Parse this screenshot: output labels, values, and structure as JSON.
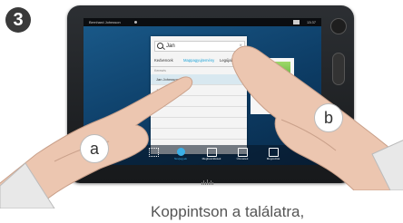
{
  "step_number": "3",
  "screen": {
    "status_bar": {
      "user": "Bernhard Johnsson",
      "time": "13:37"
    },
    "search": {
      "query": "Jan"
    },
    "tabs": [
      "Kedvencek",
      "Mappagyujtemény",
      "Legújabbak"
    ],
    "section_label": "Keresés",
    "results": [
      {
        "name": "Jan Johnsson",
        "selected": true
      },
      {
        "name": "Jan Nielsen",
        "selected": false
      },
      {
        "name": "",
        "selected": false
      },
      {
        "name": "",
        "selected": false
      },
      {
        "name": "",
        "selected": false
      },
      {
        "name": "",
        "selected": false
      }
    ],
    "bottom_bar": [
      {
        "label": "",
        "icon": "keypad-icon"
      },
      {
        "label": "Névjegyek",
        "icon": "contacts-icon",
        "active": true
      },
      {
        "label": "Megbeszélések",
        "icon": "calendar-icon"
      },
      {
        "label": "Üzenetek",
        "icon": "messages-icon"
      },
      {
        "label": "Megosztás",
        "icon": "share-icon"
      }
    ]
  },
  "markers": {
    "left": "a",
    "right": "b"
  },
  "caption": "Koppintson a találatra,",
  "colors": {
    "accent": "#1fa4d8",
    "screen_bg": "#0d3d66",
    "skin": "#ecc6b0"
  }
}
